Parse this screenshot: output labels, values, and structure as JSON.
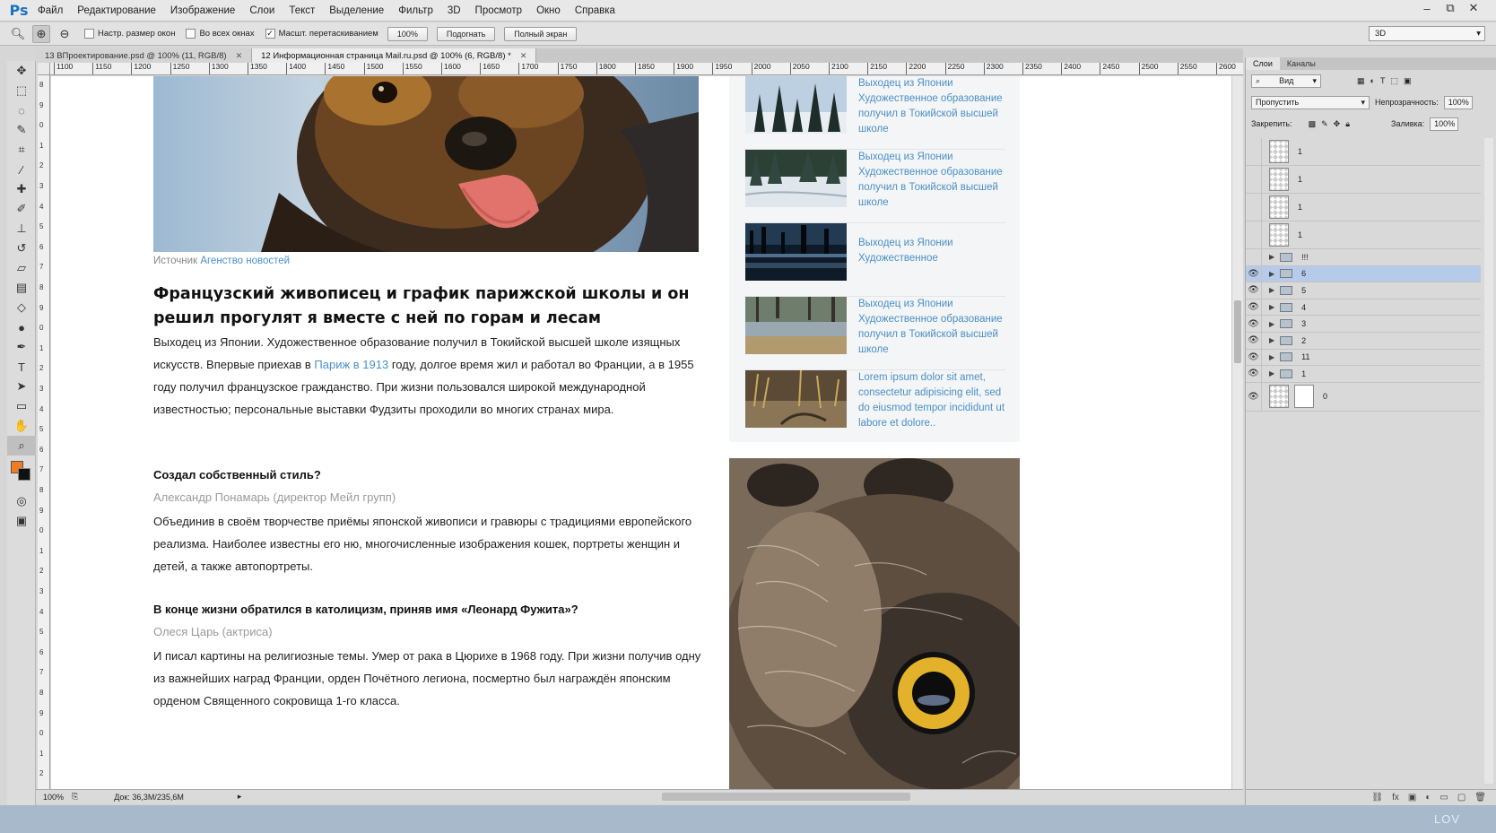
{
  "app": {
    "logo": "Ps",
    "menu": [
      "Файл",
      "Редактирование",
      "Изображение",
      "Слои",
      "Текст",
      "Выделение",
      "Фильтр",
      "3D",
      "Просмотр",
      "Окно",
      "Справка"
    ],
    "window_controls": [
      "–",
      "⧉",
      "✕"
    ]
  },
  "options_bar": {
    "resize_windows_label": "Настр. размер окон",
    "all_windows_label": "Во всех окнах",
    "scrubby_zoom_label": "Масшт. перетаскиванием",
    "zoom_100_label": "100%",
    "fit_label": "Подогнать",
    "fill_screen_label": "Полный экран",
    "workspace_value": "3D"
  },
  "tabs": [
    {
      "label": "13 ВПроектирование.psd @ 100% (11, RGB/8)",
      "active": false
    },
    {
      "label": "12 Информационная страница Mail.ru.psd @ 100% (6, RGB/8) *",
      "active": true
    }
  ],
  "ruler": {
    "top_labels": [
      "1100",
      "1150",
      "1200",
      "1250",
      "1300",
      "1350",
      "1400",
      "1450",
      "1500",
      "1550",
      "1600",
      "1650",
      "1700",
      "1750",
      "1800",
      "1850",
      "1900",
      "1950",
      "2000",
      "2050",
      "2100",
      "2150",
      "2200",
      "2250",
      "2300",
      "2350",
      "2400",
      "2450",
      "2500",
      "2550",
      "2600"
    ],
    "left_labels": [
      "8",
      "9",
      "0",
      "1",
      "2",
      "3",
      "4",
      "5",
      "6",
      "7",
      "8",
      "9",
      "0",
      "1",
      "2",
      "3",
      "4",
      "5",
      "6",
      "7",
      "8",
      "9",
      "0",
      "1",
      "2",
      "3",
      "4",
      "5",
      "6",
      "7",
      "8",
      "9",
      "0",
      "1",
      "2"
    ]
  },
  "status": {
    "zoom": "100%",
    "doc": "Док: 36,3M/235,6M"
  },
  "layers_panel": {
    "tabs": [
      "Слои",
      "Каналы"
    ],
    "filter_label": "Вид",
    "blend_mode": "Пропустить",
    "opacity_label": "Непрозрачность:",
    "opacity_value": "100%",
    "lock_label": "Закрепить:",
    "fill_label": "Заливка:",
    "fill_value": "100%",
    "layers": [
      {
        "name": "1",
        "type": "smart",
        "visible": false
      },
      {
        "name": "1",
        "type": "smart",
        "visible": false
      },
      {
        "name": "1",
        "type": "smart",
        "visible": false
      },
      {
        "name": "1",
        "type": "smart",
        "visible": false
      },
      {
        "name": "!!!",
        "type": "group",
        "visible": false
      },
      {
        "name": "6",
        "type": "group",
        "visible": true,
        "selected": true
      },
      {
        "name": "5",
        "type": "group",
        "visible": true
      },
      {
        "name": "4",
        "type": "group",
        "visible": true
      },
      {
        "name": "3",
        "type": "group",
        "visible": true
      },
      {
        "name": "2",
        "type": "group",
        "visible": true
      },
      {
        "name": "11",
        "type": "group",
        "visible": true
      },
      {
        "name": "1",
        "type": "group",
        "visible": true
      },
      {
        "name": "0",
        "type": "masked",
        "visible": true
      }
    ]
  },
  "page": {
    "caption_prefix": "Источник",
    "caption_link": "Агенство новостей",
    "title": "Французский живописец и график парижской школы и он решил прогулят я вместе с ней по горам и лесам",
    "p1_a": "Выходец из Японии. Художественное образование получил в Токийской высшей школе изящных искусств. Впервые приехав в ",
    "p1_link": "Париж в 1913",
    "p1_b": " году, долгое время жил и работал во Франции, а в 1955 году получил французское гражданство. При жизни пользовался широкой международной известностью; персональные выставки Фудзиты проходили во многих странах мира.",
    "q1": "Создал собственный стиль?",
    "q1_author": "Александр Понамарь (директор Мейл групп)",
    "a1": "Объединив в своём творчестве приёмы японской живописи и гравюры с традициями европейского реализма. Наиболее известны его ню, многочисленные изображения кошек, портреты женщин и детей, а также автопортреты.",
    "q2": "В конце жизни обратился в католицизм, приняв имя «Леонард Фужита»?",
    "q2_author": "Олеся Царь (актриса)",
    "a2": "И писал картины на религиозные темы. Умер от рака в Цюрихе в 1968 году. При жизни получив одну из важнейших наград Франции, орден Почётного легиона, посмертно был награждён японским орденом Священного сокровища 1-го класса.",
    "sidebar": [
      {
        "text": "Выходец из Японии Художественное образование получил в Токийской высшей школе"
      },
      {
        "text": "Выходец из Японии Художественное образование получил в Токийской высшей школе"
      },
      {
        "text": "Выходец из Японии Художественное"
      },
      {
        "text": "Выходец из Японии Художественное образование получил в Токийской высшей школе"
      },
      {
        "text": "Lorem ipsum dolor sit amet, consectetur adipisicing elit, sed do eiusmod tempor incididunt ut labore et dolore.."
      }
    ]
  },
  "watermark": "LOV",
  "colors": {
    "link": "#4a90c9",
    "fg_swatch": "#f47b20",
    "selected_layer": "#b6cbea"
  }
}
